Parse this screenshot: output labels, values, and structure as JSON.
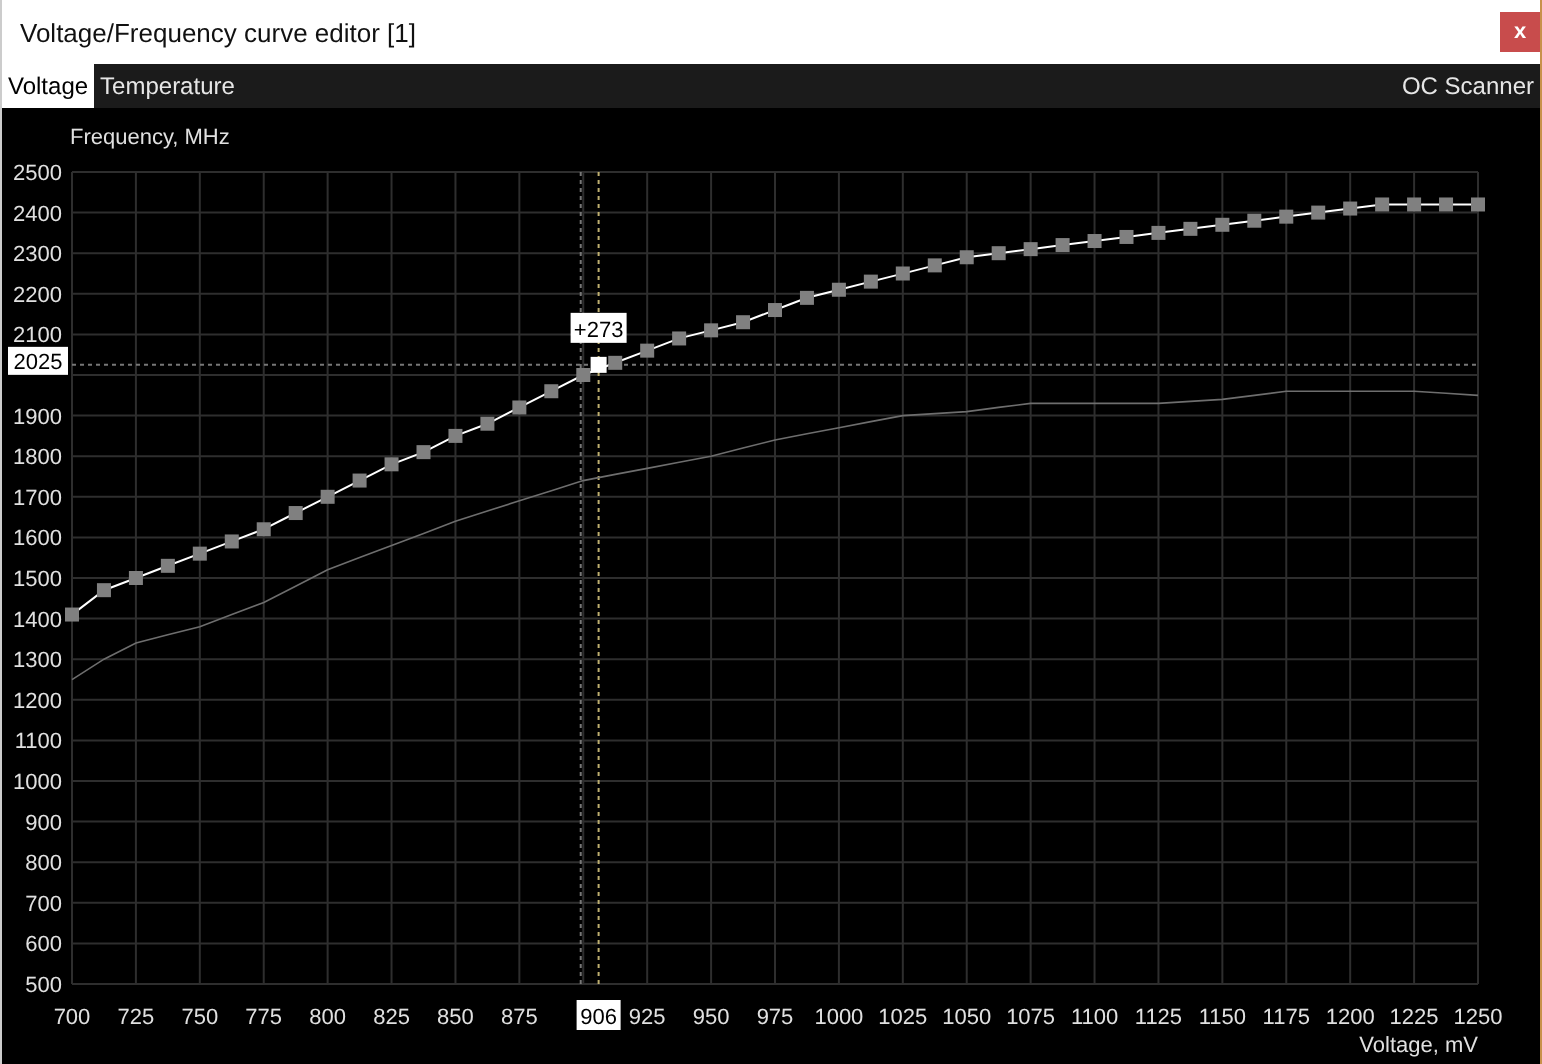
{
  "window": {
    "title": "Voltage/Frequency curve editor [1]",
    "close": "x"
  },
  "tabs": [
    {
      "label": "Voltage",
      "selected": true
    },
    {
      "label": "Temperature",
      "selected": false
    }
  ],
  "oc_scanner": "OC Scanner",
  "cursor": {
    "voltage": "906",
    "frequency": "2025"
  },
  "chart_data": {
    "type": "line",
    "grid": true,
    "ylabel": "Frequency, MHz",
    "xlabel": "Voltage, mV",
    "xlim": [
      700,
      1250
    ],
    "ylim": [
      500,
      2500
    ],
    "xticks": [
      700,
      725,
      750,
      775,
      800,
      825,
      850,
      875,
      925,
      950,
      975,
      1000,
      1025,
      1050,
      1075,
      1100,
      1125,
      1150,
      1175,
      1200,
      1225,
      1250
    ],
    "yticks": [
      500,
      600,
      700,
      800,
      900,
      1000,
      1100,
      1200,
      1300,
      1400,
      1500,
      1600,
      1700,
      1800,
      1900,
      2100,
      2200,
      2300,
      2400,
      2500
    ],
    "x": [
      700,
      712.5,
      725,
      737.5,
      750,
      762.5,
      775,
      787.5,
      800,
      812.5,
      825,
      837.5,
      850,
      862.5,
      875,
      887.5,
      900,
      912.5,
      925,
      937.5,
      950,
      962.5,
      975,
      987.5,
      1000,
      1012.5,
      1025,
      1037.5,
      1050,
      1062.5,
      1075,
      1087.5,
      1100,
      1112.5,
      1125,
      1137.5,
      1150,
      1162.5,
      1175,
      1187.5,
      1200,
      1212.5,
      1225,
      1237.5,
      1250
    ],
    "series": [
      {
        "color": "#808080",
        "marker": "square",
        "values": [
          1410,
          1470,
          1500,
          1530,
          1560,
          1590,
          1620,
          1660,
          1700,
          1740,
          1780,
          1810,
          1850,
          1880,
          1920,
          1960,
          2000,
          2030,
          2060,
          2090,
          2110,
          2130,
          2160,
          2190,
          2210,
          2230,
          2250,
          2270,
          2290,
          2300,
          2310,
          2320,
          2330,
          2340,
          2350,
          2360,
          2370,
          2380,
          2390,
          2400,
          2410,
          2420,
          2420,
          2420,
          2420
        ]
      },
      {
        "color": "#6e6e6e",
        "values": [
          1250,
          1300,
          1340,
          1360,
          1380,
          1410,
          1440,
          1480,
          1520,
          1550,
          1580,
          1610,
          1640,
          1665,
          1690,
          1715,
          1740,
          1755,
          1770,
          1785,
          1800,
          1820,
          1840,
          1855,
          1870,
          1885,
          1900,
          1905,
          1910,
          1920,
          1930,
          1930,
          1930,
          1930,
          1930,
          1935,
          1940,
          1950,
          1960,
          1960,
          1960,
          1960,
          1960,
          1955,
          1950
        ]
      }
    ],
    "ref_lines": [
      {
        "axis": "x",
        "value": 899,
        "color": "#777777"
      },
      {
        "axis": "x",
        "value": 906,
        "color": "#bfb070"
      },
      {
        "axis": "y",
        "value": 2025,
        "color": "#777777"
      }
    ],
    "annotations": [
      {
        "x": 906,
        "y": 2025,
        "text": "+273"
      }
    ]
  }
}
